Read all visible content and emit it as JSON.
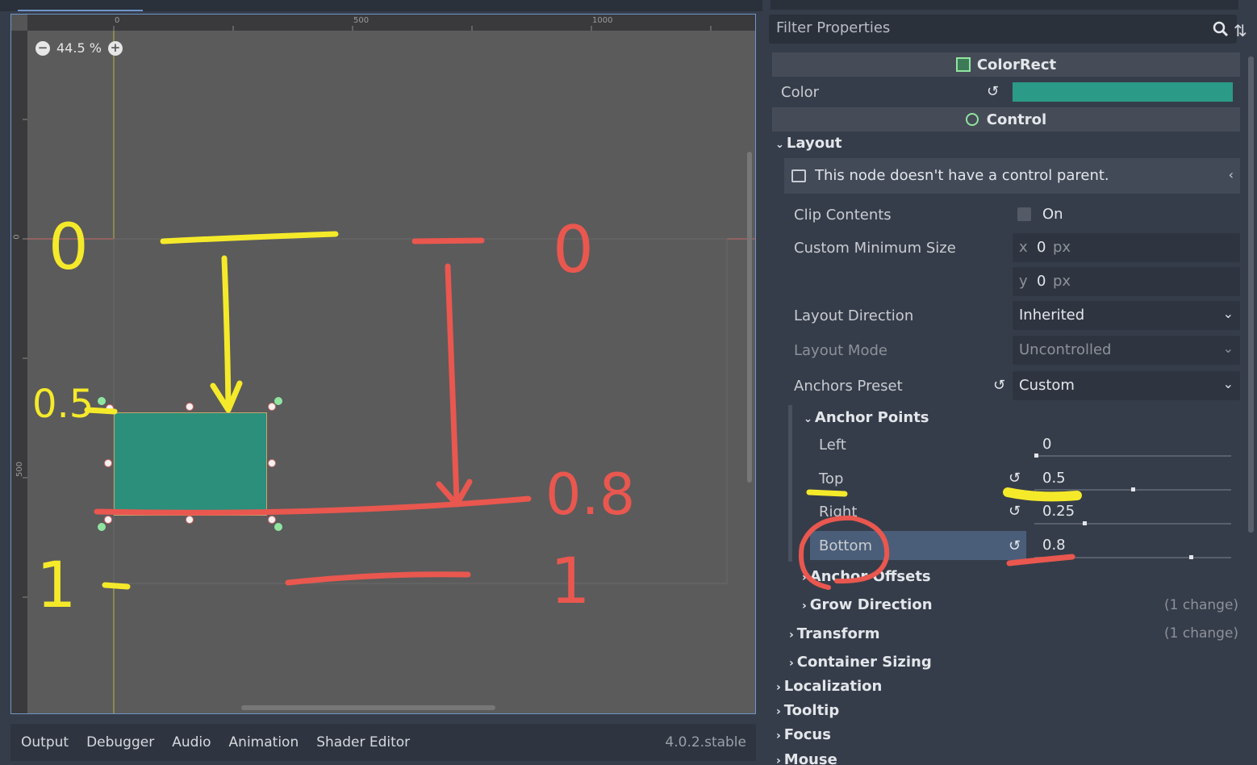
{
  "viewport": {
    "zoom_label": "44.5 %",
    "ruler_top": [
      "0",
      "500",
      "1000"
    ],
    "ruler_left": [
      "0",
      "500"
    ]
  },
  "annotations": {
    "yellow_labels": [
      "0",
      "0.5",
      "1"
    ],
    "red_labels": [
      "0",
      "0.8",
      "1"
    ],
    "yellow_color": "#f5ea2a",
    "red_color": "#e9574f"
  },
  "bottom_panel": {
    "tabs": [
      "Output",
      "Debugger",
      "Audio",
      "Animation",
      "Shader Editor"
    ],
    "version": "4.0.2.stable"
  },
  "inspector": {
    "filter_placeholder": "Filter Properties",
    "colorrect_header": "ColorRect",
    "color_label": "Color",
    "color_value": "#2b9a87",
    "control_header": "Control",
    "layout_group": "Layout",
    "warning": "This node doesn't have a control parent.",
    "clip_contents": {
      "label": "Clip Contents",
      "value": "On"
    },
    "custom_min_size": {
      "label": "Custom Minimum Size",
      "x_label": "x",
      "x": "0",
      "y_label": "y",
      "y": "0",
      "unit": "px"
    },
    "layout_direction": {
      "label": "Layout Direction",
      "value": "Inherited"
    },
    "layout_mode": {
      "label": "Layout Mode",
      "value": "Uncontrolled"
    },
    "anchors_preset": {
      "label": "Anchors Preset",
      "value": "Custom"
    },
    "anchor_points": {
      "label": "Anchor Points",
      "left": {
        "label": "Left",
        "value": "0",
        "fraction": 0
      },
      "top": {
        "label": "Top",
        "value": "0.5",
        "fraction": 0.5
      },
      "right": {
        "label": "Right",
        "value": "0.25",
        "fraction": 0.25
      },
      "bottom": {
        "label": "Bottom",
        "value": "0.8",
        "fraction": 0.8
      }
    },
    "anchor_offsets": "Anchor Offsets",
    "grow_direction": {
      "label": "Grow Direction",
      "change": "(1 change)"
    },
    "transform": {
      "label": "Transform",
      "change": "(1 change)"
    },
    "container_sizing": "Container Sizing",
    "localization": "Localization",
    "tooltip": "Tooltip",
    "focus": "Focus",
    "mouse": "Mouse"
  }
}
